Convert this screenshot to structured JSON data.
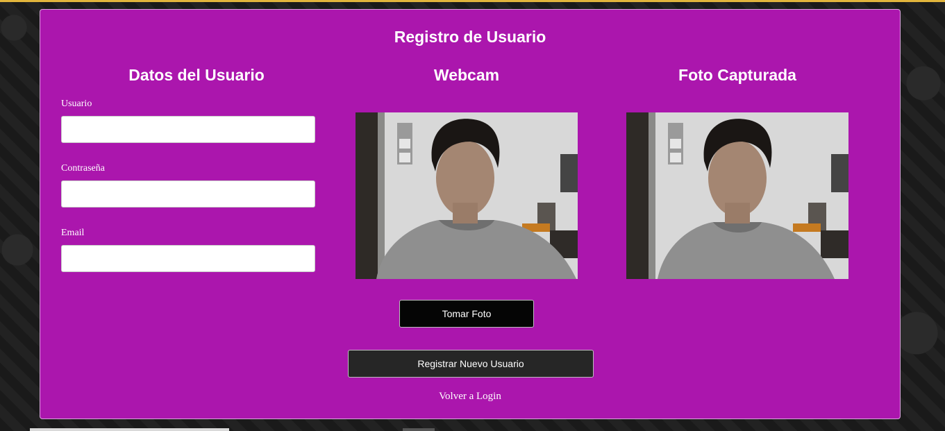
{
  "page": {
    "title": "Registro de Usuario"
  },
  "user_data": {
    "heading": "Datos del Usuario",
    "fields": [
      {
        "label": "Usuario",
        "value": "",
        "placeholder": ""
      },
      {
        "label": "Contraseña",
        "value": "",
        "placeholder": ""
      },
      {
        "label": "Email",
        "value": "",
        "placeholder": ""
      }
    ]
  },
  "webcam": {
    "heading": "Webcam"
  },
  "captured": {
    "heading": "Foto Capturada"
  },
  "actions": {
    "take_photo_label": "Tomar Foto",
    "register_label": "Registrar Nuevo Usuario",
    "back_to_login_label": "Volver a Login"
  },
  "colors": {
    "card_background": "#ab16ad",
    "page_background": "#1c1c1c",
    "button_dark": "#050505",
    "button_register": "#262626",
    "top_accent": "#e2b53c"
  }
}
